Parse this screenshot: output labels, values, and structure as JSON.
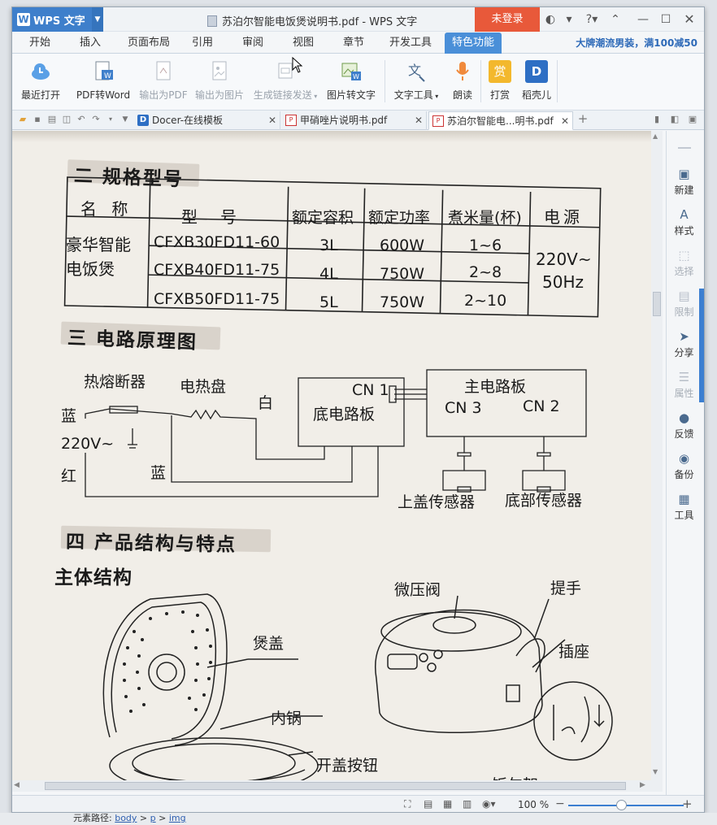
{
  "app": {
    "name": "WPS 文字",
    "logo": "W",
    "window_title": "苏泊尔智能电饭煲说明书.pdf - WPS 文字",
    "login_label": "未登录"
  },
  "menu": {
    "tabs": [
      "开始",
      "插入",
      "页面布局",
      "引用",
      "审阅",
      "视图",
      "章节",
      "开发工具",
      "特色功能"
    ],
    "active": "特色功能",
    "promo": "大牌潮流男装，满100减50"
  },
  "ribbon": [
    {
      "label": "最近打开",
      "icon": "cloud-icon",
      "enabled": true
    },
    {
      "label": "PDF转Word",
      "icon": "pdf-to-word-icon",
      "enabled": true
    },
    {
      "label": "输出为PDF",
      "icon": "export-pdf-icon",
      "enabled": false
    },
    {
      "label": "输出为图片",
      "icon": "export-image-icon",
      "enabled": false
    },
    {
      "label": "生成链接发送",
      "icon": "share-link-icon",
      "enabled": false
    },
    {
      "label": "图片转文字",
      "icon": "image-to-text-icon",
      "enabled": true
    },
    {
      "label": "文字工具",
      "icon": "text-tools-icon",
      "enabled": true
    },
    {
      "label": "朗读",
      "icon": "microphone-icon",
      "enabled": true
    },
    {
      "label": "打赏",
      "icon": "reward-icon",
      "enabled": true,
      "glyph": "赏"
    },
    {
      "label": "稻壳儿",
      "icon": "docer-icon",
      "enabled": true,
      "glyph": "D"
    }
  ],
  "doc_tabs": [
    {
      "label": "Docer-在线模板",
      "active": false
    },
    {
      "label": "甲硝唑片说明书.pdf",
      "active": false
    },
    {
      "label": "苏泊尔智能电...明书.pdf",
      "active": true
    }
  ],
  "right_panel": [
    {
      "label": "新建",
      "enabled": true,
      "glyph": "▣"
    },
    {
      "label": "样式",
      "enabled": true,
      "glyph": "A"
    },
    {
      "label": "选择",
      "enabled": false,
      "glyph": "⬚"
    },
    {
      "label": "限制",
      "enabled": false,
      "glyph": "▤"
    },
    {
      "label": "分享",
      "enabled": true,
      "glyph": "➤"
    },
    {
      "label": "属性",
      "enabled": false,
      "glyph": "☰"
    },
    {
      "label": "反馈",
      "enabled": true,
      "glyph": "●"
    },
    {
      "label": "备份",
      "enabled": true,
      "glyph": "◉"
    },
    {
      "label": "工具",
      "enabled": true,
      "glyph": "▦"
    }
  ],
  "status": {
    "zoom": "100 %"
  },
  "under_bar": {
    "prefix": "元素路径:",
    "path": [
      "body",
      "p",
      "img"
    ]
  },
  "document": {
    "section2": {
      "title": "二 规格型号"
    },
    "spec_table": {
      "headers": [
        "名 称",
        "型　号",
        "额定容积",
        "额定功率",
        "煮米量(杯)",
        "电源"
      ],
      "name_line1": "豪华智能",
      "name_line2": "电饭煲",
      "rows": [
        {
          "model": "CFXB30FD11-60",
          "capacity": "3L",
          "power": "600W",
          "rice": "1~6"
        },
        {
          "model": "CFXB40FD11-75",
          "capacity": "4L",
          "power": "750W",
          "rice": "2~8"
        },
        {
          "model": "CFXB50FD11-75",
          "capacity": "5L",
          "power": "750W",
          "rice": "2~10"
        }
      ],
      "power_line1": "220V~",
      "power_line2": "50Hz"
    },
    "section3": {
      "title": "三 电路原理图",
      "labels": {
        "fuse": "热熔断器",
        "heater": "电热盘",
        "white": "白",
        "blue1": "蓝",
        "voltage": "220V~",
        "red": "红",
        "blue2": "蓝",
        "cn1": "CN 1",
        "bottom_board": "底电路板",
        "main_board": "主电路板",
        "cn3": "CN 3",
        "cn2": "CN 2",
        "lid_sensor": "上盖传感器",
        "bottom_sensor": "底部传感器"
      }
    },
    "section4": {
      "title": "四 产品结构与特点",
      "subtitle": "主体结构",
      "labels": {
        "valve": "微压阀",
        "handle": "提手",
        "lid": "煲盖",
        "socket": "插座",
        "inner_pot": "内锅",
        "open_button": "开盖按钮",
        "spoon_rack": "饭勺架"
      }
    }
  }
}
